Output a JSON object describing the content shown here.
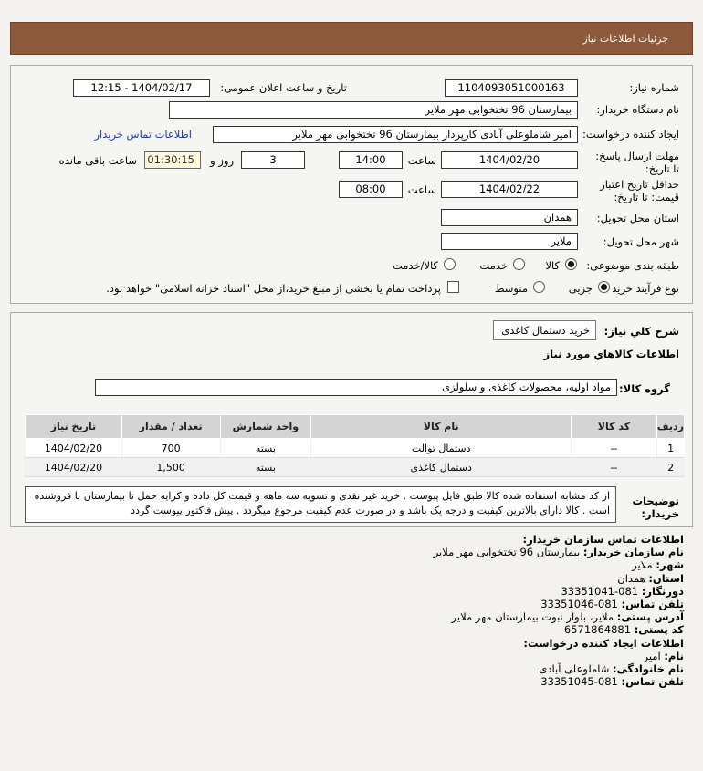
{
  "header": {
    "title": "جزئیات اطلاعات نیاز"
  },
  "need": {
    "number_label": "شماره نیاز:",
    "number": "1104093051000163",
    "announce_label": "تاریخ و ساعت اعلان عمومی:",
    "announce": "1404/02/17 - 12:15",
    "buyer_label": "نام دستگاه خریدار:",
    "buyer": "بیمارستان 96 تختخوابی مهر ملایر",
    "creator_label": "ایجاد کننده درخواست:",
    "creator": "امیر شاملوعلی آبادی کارپرداز بیمارستان 96 تختخوابی مهر ملایر",
    "buyer_contact_link": "اطلاعات تماس خریدار",
    "reply_label": "مهلت ارسال پاسخ: تا تاریخ:",
    "reply_date": "1404/02/20",
    "time_label": "ساعت",
    "reply_time": "14:00",
    "days": "3",
    "days_label": "روز و",
    "countdown": "01:30:15",
    "remaining_label": "ساعت باقی مانده",
    "price_label": "حداقل تاریخ اعتبار قیمت: تا تاریخ:",
    "price_date": "1404/02/22",
    "price_time": "08:00",
    "province_label": "استان محل تحویل:",
    "province": "همدان",
    "city_label": "شهر محل تحویل:",
    "city": "ملایر",
    "category_label": "طبقه بندی موضوعی:",
    "category_options": [
      "کالا",
      "خدمت",
      "کالا/خدمت"
    ],
    "process_label": "نوع فرآیند خرید :",
    "process_options": [
      "جزیی",
      "متوسط"
    ],
    "payment_note": "پرداخت تمام یا بخشی از مبلغ خرید،از محل \"اسناد خزانه اسلامی\" خواهد بود."
  },
  "summary": {
    "general_label": "شرح کلي نياز:",
    "general": "خرید دستمال کاغذی",
    "goods_info_label": "اطلاعات کالاهاي مورد نياز",
    "group_label": "گروه کالا:",
    "group": "مواد اولیه، محصولات کاغذی و سلولزی"
  },
  "table": {
    "headers": [
      "ردیف",
      "کد کالا",
      "نام کالا",
      "واحد شمارش",
      "تعداد / مقدار",
      "تاریخ نیاز"
    ],
    "rows": [
      [
        "1",
        "--",
        "دستمال توالت",
        "بسته",
        "700",
        "1404/02/20"
      ],
      [
        "2",
        "--",
        "دستمال کاغذی",
        "بسته",
        "1,500",
        "1404/02/20"
      ]
    ]
  },
  "notes": {
    "label": "توضیحات خریدار:",
    "text": "از کد مشابه استفاده شده کالا طبق فایل پیوست . خرید غیر نقدی و تسویه سه ماهه و قیمت کل داده و کرایه حمل تا بیمارستان با فروشنده است . کالا دارای بالاترین کیفیت و درجه یک باشد و در صورت عدم کیفیت مرجوع میگردد . پیش فاکتور پیوست گردد"
  },
  "contact": {
    "title": "اطلاعات تماس سازمان خریدار:",
    "org_label": "نام سازمان خریدار:",
    "org": "بیمارستان 96 تختخوابی مهر ملایر",
    "city_label": "شهر:",
    "city": "ملایر",
    "province_label": "استان:",
    "province": "همدان",
    "fax_label": "دورنگار:",
    "fax": "081-33351041",
    "phone_label": "تلفن تماس:",
    "phone": "081-33351046",
    "address_label": "آدرس پستی:",
    "address": "ملایر، بلوار نبوت بیمارستان مهر ملایر",
    "postal_label": "کد پستی:",
    "postal": "6571864881",
    "creator_title": "اطلاعات ایجاد کننده درخواست:",
    "name_label": "نام:",
    "name": "امیر",
    "family_label": "نام خانوادگی:",
    "family": "شاملوعلی آبادی",
    "creator_phone_label": "تلفن تماس:",
    "creator_phone": "081-33351045"
  }
}
